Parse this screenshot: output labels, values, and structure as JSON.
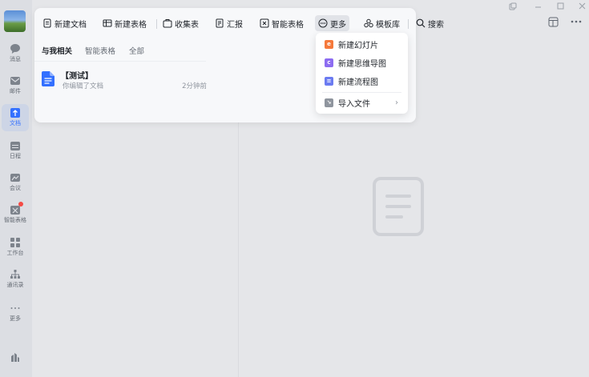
{
  "rail": {
    "items": [
      {
        "label": "消息",
        "icon": "chat-bubble-icon"
      },
      {
        "label": "邮件",
        "icon": "mail-icon"
      },
      {
        "label": "文档",
        "icon": "docs-icon",
        "active": true
      },
      {
        "label": "日程",
        "icon": "calendar-icon"
      },
      {
        "label": "会议",
        "icon": "meeting-icon"
      },
      {
        "label": "智能表格",
        "icon": "smart-sheet-icon",
        "badge": true
      },
      {
        "label": "工作台",
        "icon": "workbench-icon"
      },
      {
        "label": "通讯录",
        "icon": "contacts-icon"
      },
      {
        "label": "更多",
        "icon": "more-dots-icon"
      }
    ]
  },
  "toolbar": {
    "new_doc": "新建文档",
    "new_sheet": "新建表格",
    "collect_form": "收集表",
    "report": "汇报",
    "smart_sheet": "智能表格",
    "more": "更多",
    "template": "模板库",
    "search": "搜索"
  },
  "tabs": {
    "related": "与我相关",
    "smart_sheet": "智能表格",
    "all": "全部"
  },
  "docs": [
    {
      "title": "【测试】",
      "subtitle": "你编辑了文档",
      "time": "2分钟前"
    }
  ],
  "dropdown": {
    "new_slides": "新建幻灯片",
    "new_mindmap": "新建思维导图",
    "new_flowchart": "新建流程图",
    "import_file": "导入文件"
  },
  "colors": {
    "accent": "#3370ff",
    "slides": "#f5793b",
    "mindmap": "#8d6cf1",
    "flowchart": "#6b7bf1",
    "badge": "#f54a45"
  }
}
